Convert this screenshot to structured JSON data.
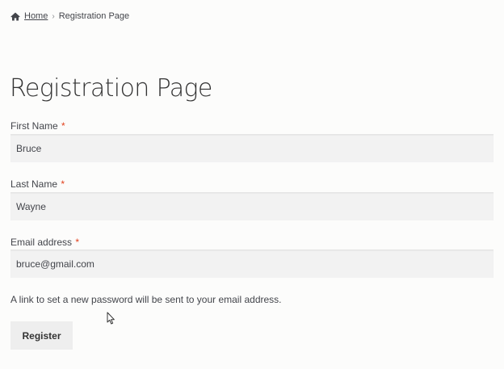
{
  "breadcrumb": {
    "home_icon": "home-icon",
    "home_label": "Home",
    "separator": "›",
    "current": "Registration Page"
  },
  "page": {
    "title": "Registration Page"
  },
  "form": {
    "required_marker": "*",
    "first_name": {
      "label": "First Name",
      "value": "Bruce"
    },
    "last_name": {
      "label": "Last Name",
      "value": "Wayne"
    },
    "email": {
      "label": "Email address",
      "value": "bruce@gmail.com"
    },
    "helper_text": "A link to set a new password will be sent to your email address.",
    "submit_label": "Register"
  },
  "colors": {
    "required": "#e2401c",
    "input_background": "#f2f2f2",
    "button_background": "#eeeeee"
  }
}
